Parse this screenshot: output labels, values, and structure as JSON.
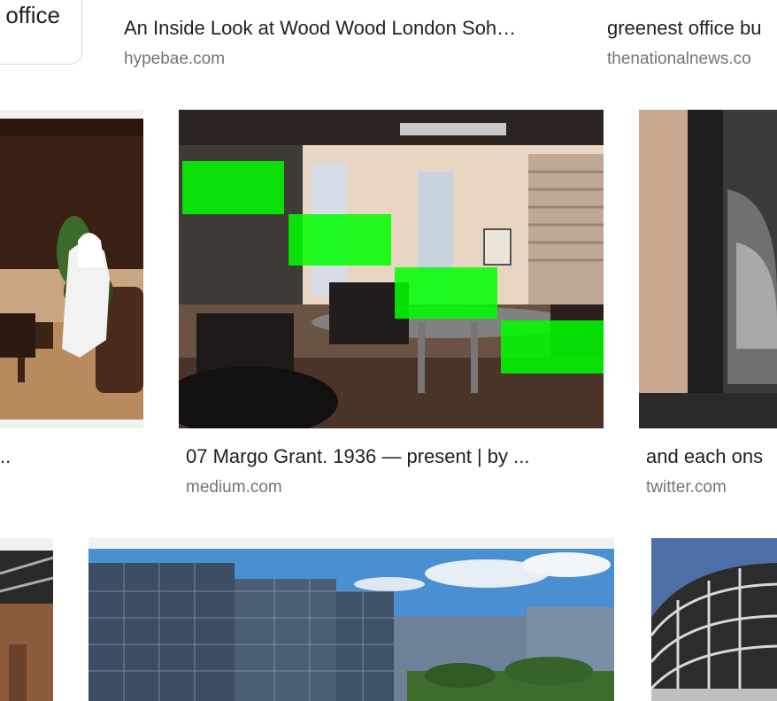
{
  "chip": {
    "label": "office"
  },
  "results": [
    {
      "title": "An Inside Look at Wood Wood London Soh…",
      "source": "hypebae.com"
    },
    {
      "title": "greenest office bu",
      "source": "thenationalnews.co"
    },
    {
      "title": "..",
      "source": ""
    },
    {
      "title": "07 Margo Grant. 1936 — present | by ...",
      "source": "medium.com"
    },
    {
      "title": "and each ons",
      "source": "twitter.com"
    }
  ],
  "images": {
    "left_meeting": "photo-meeting-room-sofa",
    "office_glass_table": "photo-office-glass-table",
    "dark_curved_wall": "photo-dark-curved-interior",
    "brick_building": "photo-brick-building",
    "glass_buildings": "photo-glass-office-buildings",
    "round_tower": "photo-round-glass-tower"
  }
}
